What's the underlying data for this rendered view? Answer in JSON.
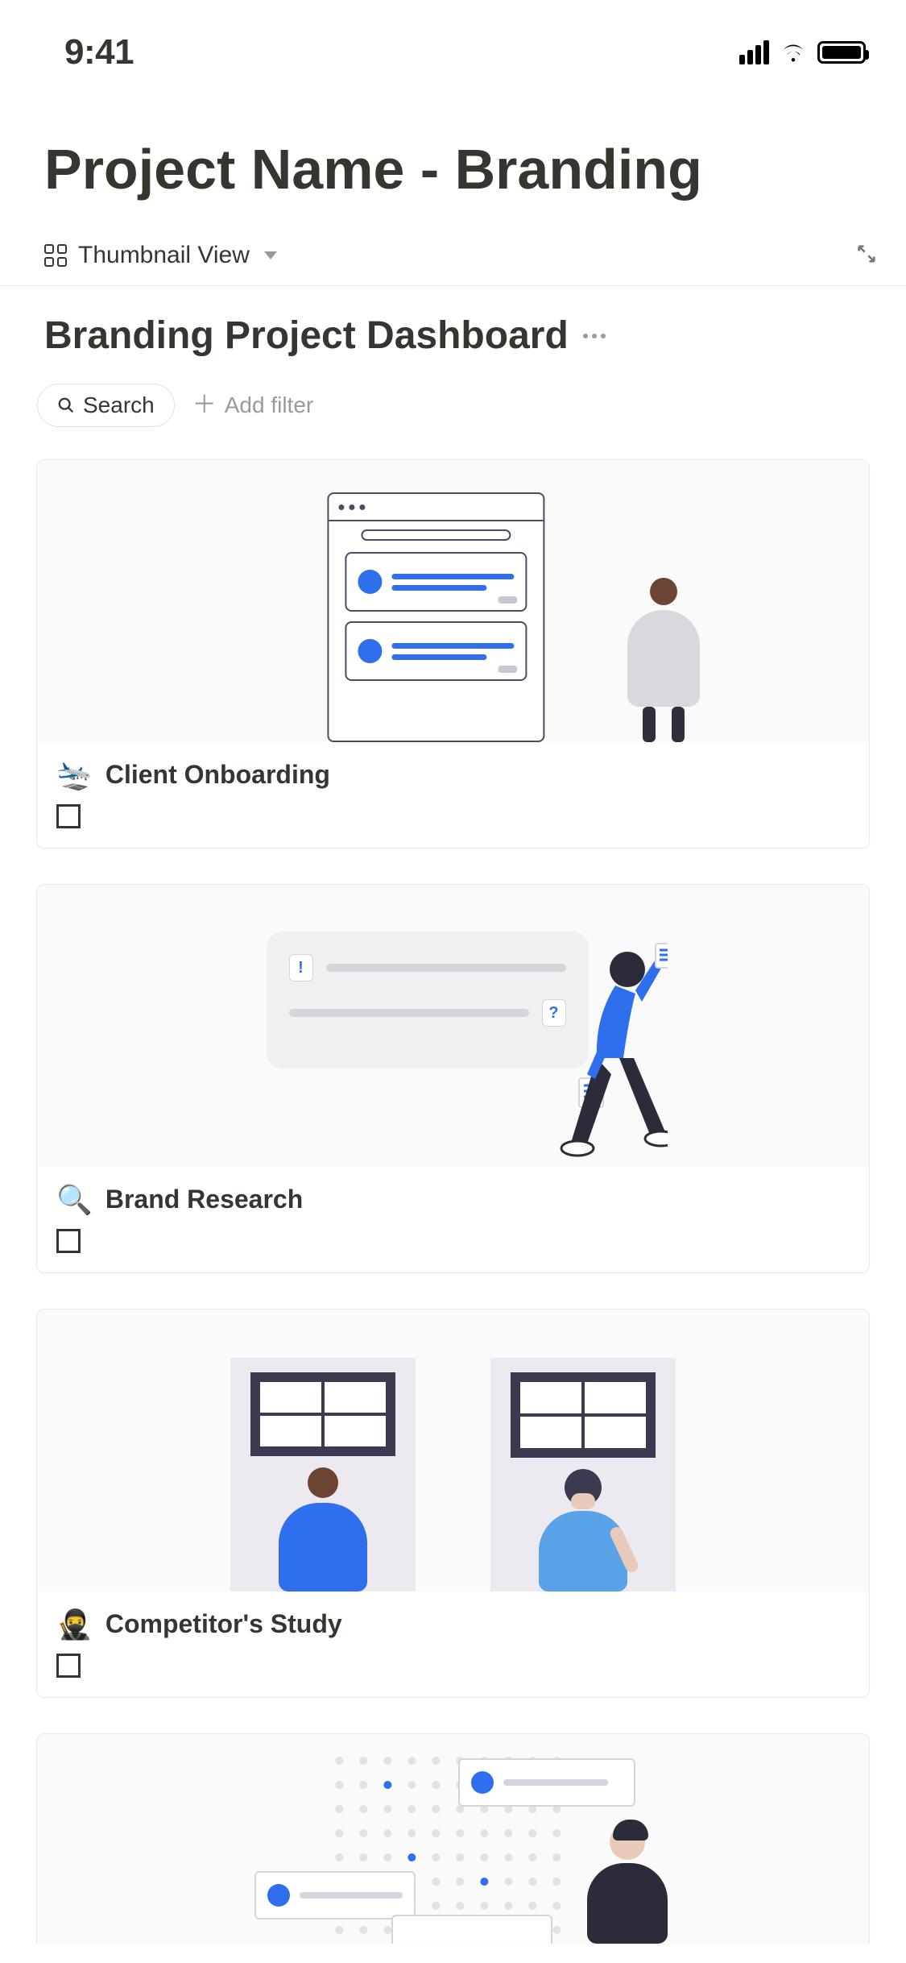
{
  "status_bar": {
    "time": "9:41"
  },
  "page": {
    "title": "Project Name - Branding"
  },
  "view_bar": {
    "label": "Thumbnail View"
  },
  "subheader": {
    "title": "Branding Project Dashboard"
  },
  "toolbar": {
    "search_label": "Search",
    "add_filter_label": "Add filter"
  },
  "cards": [
    {
      "emoji": "🛬",
      "title": "Client Onboarding"
    },
    {
      "emoji": "🔍",
      "title": "Brand Research"
    },
    {
      "emoji": "🥷",
      "title": "Competitor's Study"
    }
  ]
}
